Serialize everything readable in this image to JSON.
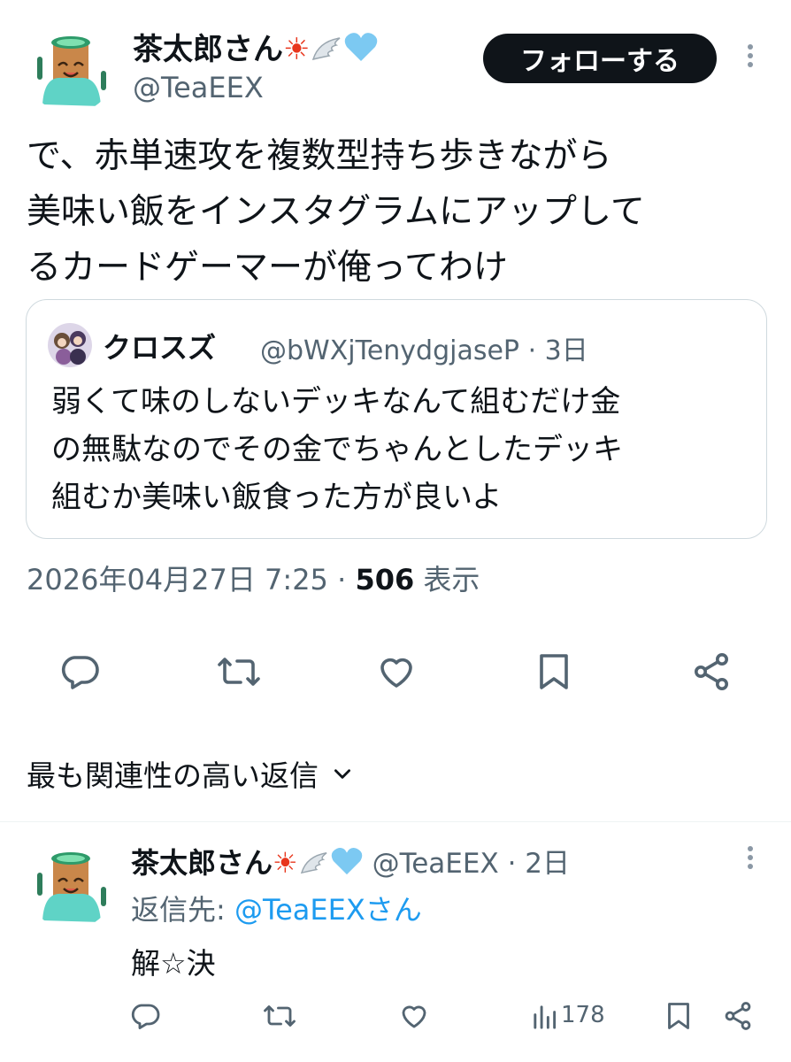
{
  "tweet": {
    "author_name": "茶太郎さん",
    "author_emojis": [
      "☀",
      "🪽",
      "🩵"
    ],
    "author_handle": "@TeaEEX",
    "follow_label": "フォローする",
    "text_lines": [
      "で、赤単速攻を複数型持ち歩きながら",
      "美味い飯をインスタグラムにアップして",
      "るカードゲーマーが俺ってわけ"
    ],
    "date": "2026年04月27日 7:25",
    "separator": " · ",
    "views": "506",
    "views_label": " 表示"
  },
  "quote": {
    "author_name": "クロスズ",
    "author_handle": "@bWXjTenydgjaseP",
    "time": "3日",
    "text_lines": [
      "弱くて味のしないデッキなんて組むだけ金",
      "の無駄なのでその金でちゃんとしたデッキ",
      "組むか美味い飯食った方が良いよ"
    ]
  },
  "actions": {
    "icons": [
      "reply-icon",
      "retweet-icon",
      "like-icon",
      "bookmark-icon",
      "share-icon"
    ]
  },
  "replies_sort": {
    "label": "最も関連性の高い返信"
  },
  "reply": {
    "author_name": "茶太郎さん",
    "author_emojis": [
      "☀",
      "🪽",
      "🩵"
    ],
    "author_handle": "@TeaEEX",
    "time": "2日",
    "reply_to_label": "返信先: ",
    "reply_to_handle": "@TeaEEXさん",
    "text": "解☆決",
    "views": "178"
  },
  "colors": {
    "text": "#0f1419",
    "secondary": "#536471",
    "link": "#1d9bf0",
    "border": "#cfd9de",
    "follow_bg": "#0f1419"
  }
}
